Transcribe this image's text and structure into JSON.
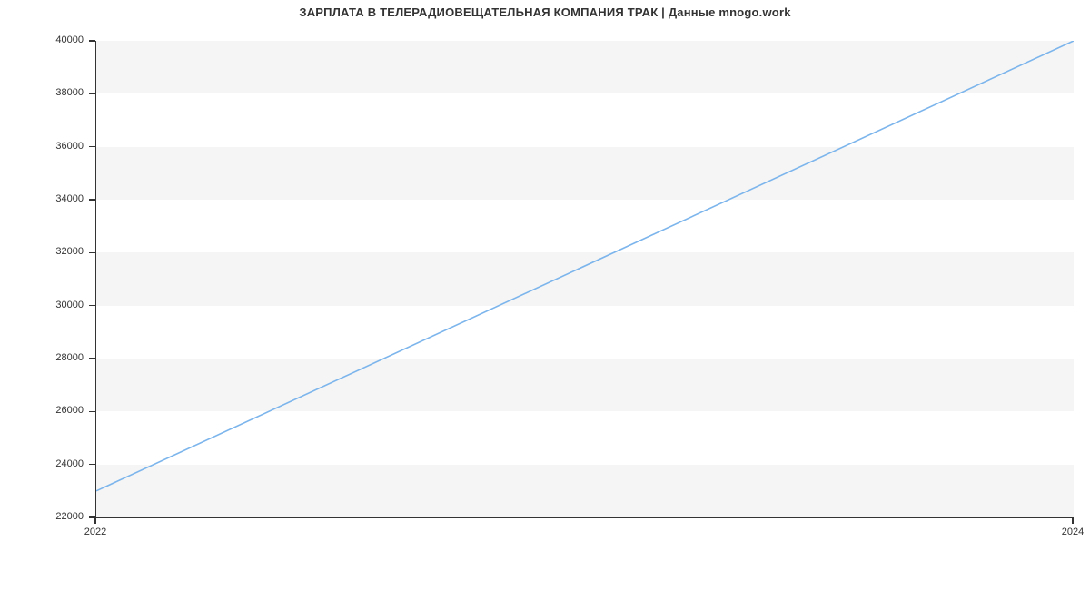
{
  "chart_data": {
    "type": "line",
    "title": "ЗАРПЛАТА В ТЕЛЕРАДИОВЕЩАТЕЛЬНАЯ КОМПАНИЯ ТРАК | Данные mnogo.work",
    "xlabel": "",
    "ylabel": "",
    "x": [
      2022,
      2024
    ],
    "values": [
      23000,
      40000
    ],
    "xlim": [
      2022,
      2024
    ],
    "ylim": [
      22000,
      40000
    ],
    "x_ticks": [
      2022,
      2024
    ],
    "y_ticks": [
      22000,
      24000,
      26000,
      28000,
      30000,
      32000,
      34000,
      36000,
      38000,
      40000
    ],
    "line_color": "#7cb5ec",
    "grid": "bands"
  },
  "title": "ЗАРПЛАТА В ТЕЛЕРАДИОВЕЩАТЕЛЬНАЯ КОМПАНИЯ ТРАК | Данные mnogo.work",
  "y_labels": [
    "22000",
    "24000",
    "26000",
    "28000",
    "30000",
    "32000",
    "34000",
    "36000",
    "38000",
    "40000"
  ],
  "x_labels": [
    "2022",
    "2024"
  ]
}
